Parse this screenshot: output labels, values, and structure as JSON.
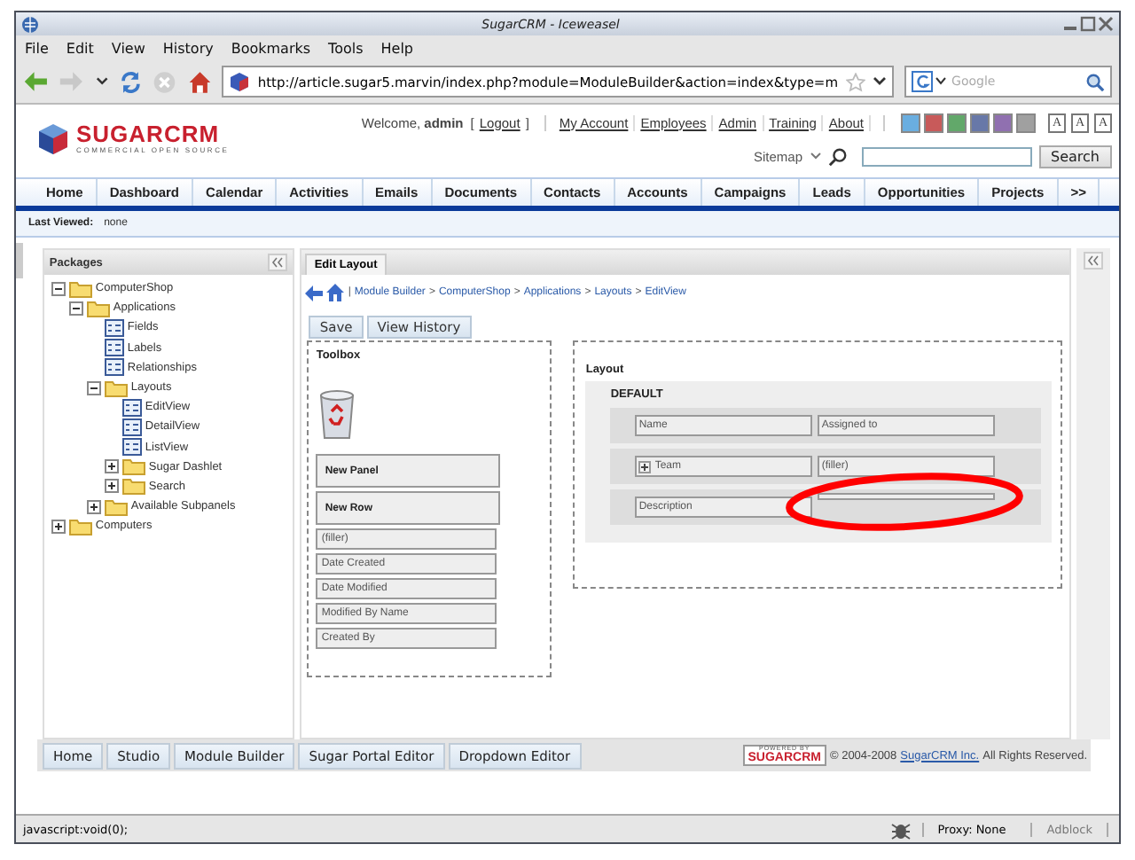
{
  "window": {
    "title": "SugarCRM - Iceweasel"
  },
  "menu": [
    "File",
    "Edit",
    "View",
    "History",
    "Bookmarks",
    "Tools",
    "Help"
  ],
  "toolbar": {
    "url": "http://article.sugar5.marvin/index.php?module=ModuleBuilder&action=index&type=m",
    "search_placeholder": "Google"
  },
  "header": {
    "logo": "SUGARCRM",
    "logo_tagline": "COMMERCIAL OPEN SOURCE",
    "welcome": "Welcome, **admin**",
    "logout_open": "[",
    "logout": "Logout",
    "logout_close": "]",
    "account_links": [
      "My Account",
      "Employees",
      "Admin",
      "Training",
      "About"
    ],
    "theme_colors": [
      {
        "color": "#6aaee0"
      },
      {
        "color": "#c85a5a"
      },
      {
        "color": "#62a86a"
      },
      {
        "color": "#6878a8"
      },
      {
        "color": "#9070b0"
      },
      {
        "color": "#a0a0a0"
      }
    ],
    "font_sizes": [
      "A",
      "A",
      "A"
    ],
    "sitemap": "Sitemap",
    "search_button": "Search"
  },
  "tabs": [
    "Home",
    "Dashboard",
    "Calendar",
    "Activities",
    "Emails",
    "Documents",
    "Contacts",
    "Accounts",
    "Campaigns",
    "Leads",
    "Opportunities",
    "Projects",
    ">>"
  ],
  "last_viewed": {
    "label": "Last Viewed:",
    "value": "none"
  },
  "packages": {
    "title": "Packages",
    "tree": [
      {
        "label": "ComputerShop",
        "kind": "folder",
        "expanded": true,
        "children": [
          {
            "label": "Applications",
            "kind": "folder",
            "expanded": true,
            "children": [
              {
                "label": "Fields",
                "kind": "view"
              },
              {
                "label": "Labels",
                "kind": "view"
              },
              {
                "label": "Relationships",
                "kind": "view"
              },
              {
                "label": "Layouts",
                "kind": "folder",
                "expanded": true,
                "children": [
                  {
                    "label": "EditView",
                    "kind": "view"
                  },
                  {
                    "label": "DetailView",
                    "kind": "view"
                  },
                  {
                    "label": "ListView",
                    "kind": "view"
                  },
                  {
                    "label": "Sugar Dashlet",
                    "kind": "folder",
                    "expanded": false
                  },
                  {
                    "label": "Search",
                    "kind": "folder",
                    "expanded": false
                  }
                ]
              },
              {
                "label": "Available Subpanels",
                "kind": "folder",
                "expanded": false
              }
            ]
          }
        ]
      },
      {
        "label": "Computers",
        "kind": "folder",
        "expanded": false
      }
    ]
  },
  "editor": {
    "tab": "Edit Layout",
    "crumb_divider": "|",
    "crumb_separator": ">",
    "breadcrumb": [
      "Module Builder",
      "ComputerShop",
      "Applications",
      "Layouts",
      "EditView"
    ],
    "buttons": [
      "Save",
      "View History"
    ],
    "toolbox": {
      "title": "Toolbox",
      "items": [
        {
          "label": "New Panel",
          "kind": "panel"
        },
        {
          "label": "New Row",
          "kind": "panel"
        },
        {
          "label": "(filler)",
          "kind": "field"
        },
        {
          "label": "Date Created",
          "kind": "field"
        },
        {
          "label": "Date Modified",
          "kind": "field"
        },
        {
          "label": "Modified By Name",
          "kind": "field"
        },
        {
          "label": "Created By",
          "kind": "field"
        }
      ]
    },
    "layout": {
      "title": "Layout",
      "panel": "DEFAULT",
      "rows": [
        [
          {
            "label": "Name",
            "kind": "field"
          },
          {
            "label": "Assigned to",
            "kind": "field"
          }
        ],
        [
          {
            "label": "Team",
            "kind": "expandable"
          },
          {
            "label": "(filler)",
            "kind": "field"
          }
        ],
        [
          {
            "label": "Description",
            "kind": "field"
          },
          {
            "kind": "empty"
          }
        ]
      ]
    }
  },
  "footer": {
    "buttons": [
      "Home",
      "Studio",
      "Module Builder",
      "Sugar Portal Editor",
      "Dropdown Editor"
    ],
    "powered_by": "POWERED BY",
    "powered_logo": "SUGARCRM",
    "copyright": "© 2004-2008",
    "company_link": "SugarCRM Inc.",
    "rights": "All Rights Reserved."
  },
  "status_bar": {
    "text": "javascript:void(0);",
    "proxy": "Proxy: None",
    "adblock": "Adblock"
  }
}
